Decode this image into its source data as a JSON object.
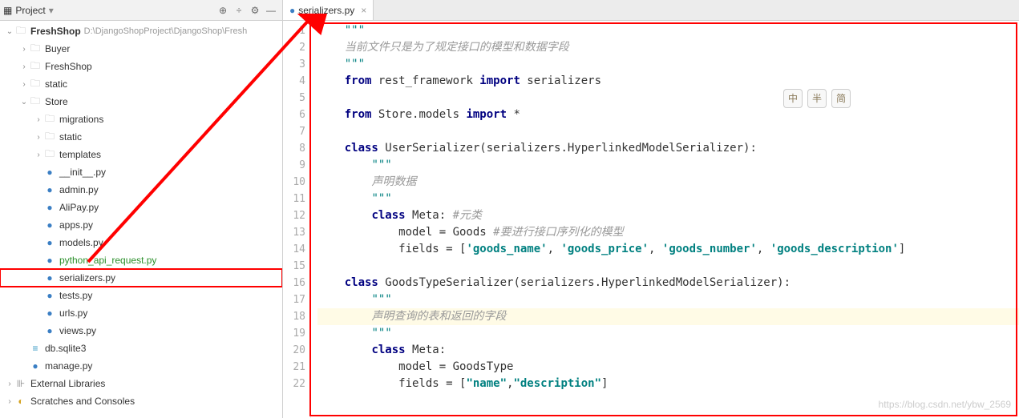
{
  "toolbar": {
    "project_label": "Project",
    "icons": [
      "target",
      "split",
      "gear",
      "hide"
    ]
  },
  "tree": [
    {
      "indent": 0,
      "arrow": "∨",
      "icon": "folder",
      "label": "FreshShop",
      "path": " D:\\DjangoShopProject\\DjangoShop\\Fresh",
      "bold": true
    },
    {
      "indent": 1,
      "arrow": ">",
      "icon": "folder",
      "label": "Buyer"
    },
    {
      "indent": 1,
      "arrow": ">",
      "icon": "folder",
      "label": "FreshShop"
    },
    {
      "indent": 1,
      "arrow": ">",
      "icon": "folder",
      "label": "static"
    },
    {
      "indent": 1,
      "arrow": "∨",
      "icon": "folder",
      "label": "Store"
    },
    {
      "indent": 2,
      "arrow": ">",
      "icon": "folder",
      "label": "migrations"
    },
    {
      "indent": 2,
      "arrow": ">",
      "icon": "folder",
      "label": "static"
    },
    {
      "indent": 2,
      "arrow": ">",
      "icon": "folder",
      "label": "templates"
    },
    {
      "indent": 2,
      "arrow": "",
      "icon": "py",
      "label": "__init__.py"
    },
    {
      "indent": 2,
      "arrow": "",
      "icon": "py",
      "label": "admin.py"
    },
    {
      "indent": 2,
      "arrow": "",
      "icon": "py",
      "label": "AliPay.py"
    },
    {
      "indent": 2,
      "arrow": "",
      "icon": "py",
      "label": "apps.py"
    },
    {
      "indent": 2,
      "arrow": "",
      "icon": "py",
      "label": "models.py"
    },
    {
      "indent": 2,
      "arrow": "",
      "icon": "py-green",
      "label": "python_api_request.py"
    },
    {
      "indent": 2,
      "arrow": "",
      "icon": "py",
      "label": "serializers.py",
      "selected": true
    },
    {
      "indent": 2,
      "arrow": "",
      "icon": "py",
      "label": "tests.py"
    },
    {
      "indent": 2,
      "arrow": "",
      "icon": "py",
      "label": "urls.py"
    },
    {
      "indent": 2,
      "arrow": "",
      "icon": "py",
      "label": "views.py"
    },
    {
      "indent": 1,
      "arrow": "",
      "icon": "db",
      "label": "db.sqlite3"
    },
    {
      "indent": 1,
      "arrow": "",
      "icon": "py",
      "label": "manage.py"
    },
    {
      "indent": 0,
      "arrow": ">",
      "icon": "lib",
      "label": "External Libraries"
    },
    {
      "indent": 0,
      "arrow": ">",
      "icon": "scratch",
      "label": "Scratches and Consoles"
    }
  ],
  "tab": {
    "filename": "serializers.py"
  },
  "code": {
    "lines": [
      {
        "n": 1,
        "tokens": [
          {
            "t": "    ",
            "c": ""
          },
          {
            "t": "\"\"\"",
            "c": "tok-str"
          }
        ]
      },
      {
        "n": 2,
        "tokens": [
          {
            "t": "    ",
            "c": ""
          },
          {
            "t": "当前文件只是为了规定接口的模型和数据字段",
            "c": "tok-com"
          }
        ]
      },
      {
        "n": 3,
        "tokens": [
          {
            "t": "    ",
            "c": ""
          },
          {
            "t": "\"\"\"",
            "c": "tok-str"
          }
        ]
      },
      {
        "n": 4,
        "tokens": [
          {
            "t": "    ",
            "c": ""
          },
          {
            "t": "from",
            "c": "tok-kw"
          },
          {
            "t": " rest_framework ",
            "c": "tok-name"
          },
          {
            "t": "import",
            "c": "tok-kw"
          },
          {
            "t": " serializers",
            "c": "tok-name"
          }
        ]
      },
      {
        "n": 5,
        "tokens": []
      },
      {
        "n": 6,
        "tokens": [
          {
            "t": "    ",
            "c": ""
          },
          {
            "t": "from",
            "c": "tok-kw"
          },
          {
            "t": " Store.models ",
            "c": "tok-name"
          },
          {
            "t": "import",
            "c": "tok-kw"
          },
          {
            "t": " *",
            "c": "tok-name"
          }
        ]
      },
      {
        "n": 7,
        "tokens": []
      },
      {
        "n": 8,
        "tokens": [
          {
            "t": "    ",
            "c": ""
          },
          {
            "t": "class",
            "c": "tok-kw"
          },
          {
            "t": " UserSerializer(serializers.HyperlinkedModelSerializer):",
            "c": "tok-name"
          }
        ]
      },
      {
        "n": 9,
        "tokens": [
          {
            "t": "        ",
            "c": ""
          },
          {
            "t": "\"\"\"",
            "c": "tok-str"
          }
        ]
      },
      {
        "n": 10,
        "tokens": [
          {
            "t": "        ",
            "c": ""
          },
          {
            "t": "声明数据",
            "c": "tok-com"
          }
        ]
      },
      {
        "n": 11,
        "tokens": [
          {
            "t": "        ",
            "c": ""
          },
          {
            "t": "\"\"\"",
            "c": "tok-str"
          }
        ]
      },
      {
        "n": 12,
        "tokens": [
          {
            "t": "        ",
            "c": ""
          },
          {
            "t": "class",
            "c": "tok-kw"
          },
          {
            "t": " Meta: ",
            "c": "tok-name"
          },
          {
            "t": "#元类",
            "c": "tok-com"
          }
        ]
      },
      {
        "n": 13,
        "tokens": [
          {
            "t": "            model = Goods ",
            "c": "tok-name"
          },
          {
            "t": "#要进行接口序列化的模型",
            "c": "tok-com"
          }
        ]
      },
      {
        "n": 14,
        "tokens": [
          {
            "t": "            fields = [",
            "c": "tok-name"
          },
          {
            "t": "'goods_name'",
            "c": "tok-field"
          },
          {
            "t": ", ",
            "c": "tok-name"
          },
          {
            "t": "'goods_price'",
            "c": "tok-field"
          },
          {
            "t": ", ",
            "c": "tok-name"
          },
          {
            "t": "'goods_number'",
            "c": "tok-field"
          },
          {
            "t": ", ",
            "c": "tok-name"
          },
          {
            "t": "'goods_description'",
            "c": "tok-field"
          },
          {
            "t": "]",
            "c": "tok-name"
          }
        ]
      },
      {
        "n": 15,
        "tokens": []
      },
      {
        "n": 16,
        "tokens": [
          {
            "t": "    ",
            "c": ""
          },
          {
            "t": "class",
            "c": "tok-kw"
          },
          {
            "t": " GoodsTypeSerializer(serializers.HyperlinkedModelSerializer):",
            "c": "tok-name"
          }
        ]
      },
      {
        "n": 17,
        "tokens": [
          {
            "t": "        ",
            "c": ""
          },
          {
            "t": "\"\"\"",
            "c": "tok-str"
          }
        ]
      },
      {
        "n": 18,
        "hl": true,
        "tokens": [
          {
            "t": "        ",
            "c": ""
          },
          {
            "t": "声明查询的表和返回的字段",
            "c": "tok-com"
          }
        ]
      },
      {
        "n": 19,
        "tokens": [
          {
            "t": "        ",
            "c": ""
          },
          {
            "t": "\"\"\"",
            "c": "tok-str"
          }
        ]
      },
      {
        "n": 20,
        "tokens": [
          {
            "t": "        ",
            "c": ""
          },
          {
            "t": "class",
            "c": "tok-kw"
          },
          {
            "t": " Meta:",
            "c": "tok-name"
          }
        ]
      },
      {
        "n": 21,
        "tokens": [
          {
            "t": "            model = GoodsType",
            "c": "tok-name"
          }
        ]
      },
      {
        "n": 22,
        "tokens": [
          {
            "t": "            fields = [",
            "c": "tok-name"
          },
          {
            "t": "\"name\"",
            "c": "tok-field"
          },
          {
            "t": ",",
            "c": "tok-name"
          },
          {
            "t": "\"description\"",
            "c": "tok-field"
          },
          {
            "t": "]",
            "c": "tok-name"
          }
        ]
      }
    ]
  },
  "ime": [
    "中",
    "半",
    "简"
  ],
  "watermark": "https://blog.csdn.net/ybw_2569"
}
